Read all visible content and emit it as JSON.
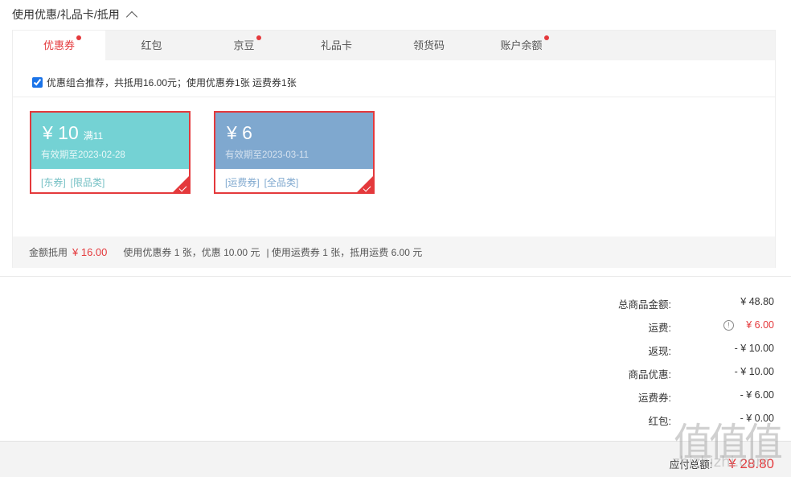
{
  "header": {
    "title": "使用优惠/礼品卡/抵用"
  },
  "tabs": [
    {
      "label": "优惠券",
      "dot": true,
      "active": true
    },
    {
      "label": "红包",
      "dot": false,
      "active": false
    },
    {
      "label": "京豆",
      "dot": true,
      "active": false
    },
    {
      "label": "礼品卡",
      "dot": false,
      "active": false
    },
    {
      "label": "领货码",
      "dot": false,
      "active": false
    },
    {
      "label": "账户余额",
      "dot": true,
      "active": false
    }
  ],
  "combo": {
    "text": "优惠组合推荐，共抵用16.00元；使用优惠券1张 运费券1张",
    "checked": true
  },
  "coupons": [
    {
      "amount": "¥ 10",
      "condition": "满11",
      "valid": "有效期至2023-02-28",
      "tags": [
        "[东券]",
        "[限品类]"
      ],
      "color": "#74d2d4",
      "selected": true
    },
    {
      "amount": "¥ 6",
      "condition": "",
      "valid": "有效期至2023-03-11",
      "tags": [
        "[运费券]",
        "[全品类]"
      ],
      "color": "#7fa8cf",
      "selected": true
    }
  ],
  "summary": {
    "label": "金额抵用",
    "amount": "¥ 16.00",
    "coupon_text": "使用优惠券 1 张，优惠 10.00 元",
    "freight_text": "| 使用运费券 1 张，抵用运费 6.00 元"
  },
  "totals": [
    {
      "label": "总商品金额:",
      "value": "¥ 48.80"
    },
    {
      "label": "运费:",
      "value": "¥ 6.00",
      "highlight": true,
      "icon": "info-icon"
    },
    {
      "label": "返现:",
      "value": "- ¥ 10.00"
    },
    {
      "label": "商品优惠:",
      "value": "- ¥ 10.00"
    },
    {
      "label": "运费券:",
      "value": "- ¥ 6.00"
    },
    {
      "label": "红包:",
      "value": "- ¥ 0.00"
    }
  ],
  "footer": {
    "label": "应付总额:",
    "value": "¥ 28.80"
  },
  "watermark": {
    "glyphs": "值值值",
    "site": "zhizhizhi.com"
  },
  "colors": {
    "accent": "#e4393c",
    "coupon_teal": "#74d2d4",
    "coupon_blue": "#7fa8cf"
  }
}
